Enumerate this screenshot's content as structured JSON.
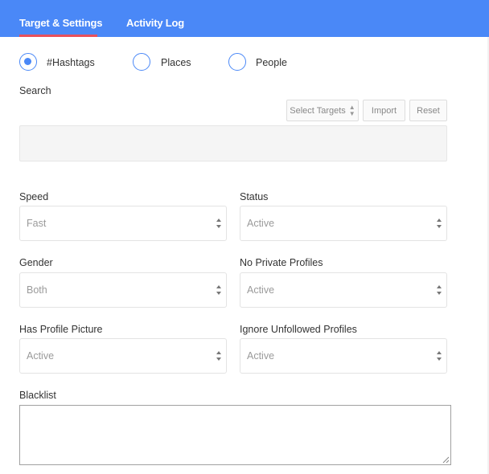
{
  "tabs": [
    {
      "label": "Target & Settings",
      "active": true
    },
    {
      "label": "Activity Log",
      "active": false
    }
  ],
  "colors": {
    "accent": "#4a88f7",
    "active_tab_underline": "#e8505b"
  },
  "target_types": {
    "selected": "#Hashtags",
    "options": [
      "#Hashtags",
      "Places",
      "People"
    ]
  },
  "search": {
    "label": "Search",
    "select_targets_label": "Select Targets",
    "import_label": "Import",
    "reset_label": "Reset",
    "value": ""
  },
  "settings": {
    "speed": {
      "label": "Speed",
      "value": "Fast"
    },
    "status": {
      "label": "Status",
      "value": "Active"
    },
    "gender": {
      "label": "Gender",
      "value": "Both"
    },
    "no_private_profiles": {
      "label": "No Private Profiles",
      "value": "Active"
    },
    "has_profile_picture": {
      "label": "Has Profile Picture",
      "value": "Active"
    },
    "ignore_unfollowed_profiles": {
      "label": "Ignore Unfollowed Profiles",
      "value": "Active"
    }
  },
  "blacklist": {
    "label": "Blacklist",
    "value": ""
  }
}
